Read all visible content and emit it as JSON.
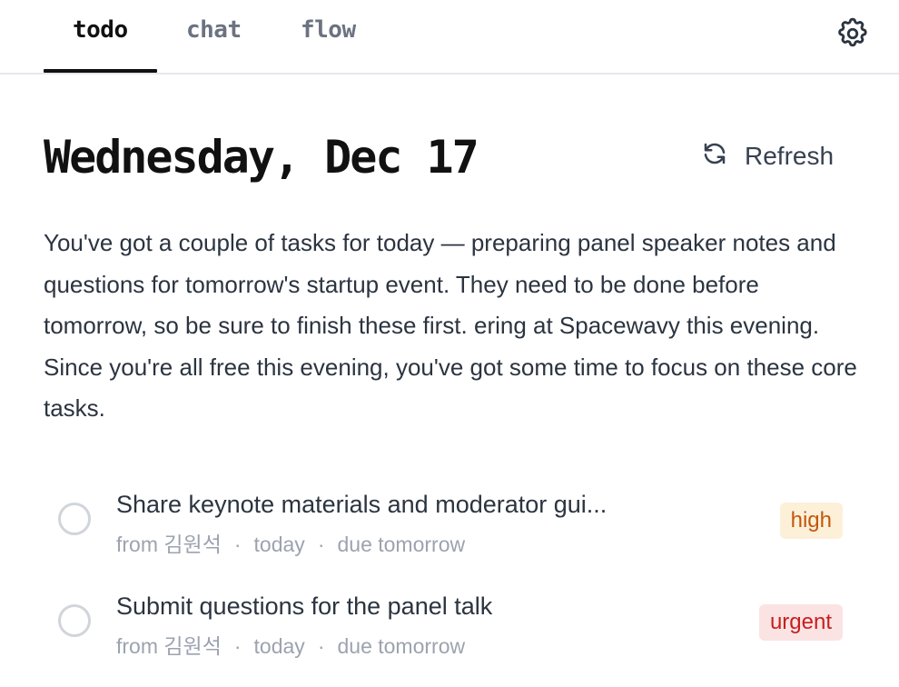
{
  "tabs": [
    {
      "label": "todo",
      "active": true
    },
    {
      "label": "chat",
      "active": false
    },
    {
      "label": "flow",
      "active": false
    }
  ],
  "settings": {
    "icon": "gear-icon"
  },
  "header": {
    "date_title": "Wednesday, Dec 17",
    "refresh_label": "Refresh",
    "refresh_icon": "refresh-icon"
  },
  "summary": "You've got a couple of tasks for today — preparing panel speaker notes and questions for tomorrow's startup event. They need to be done before tomorrow, so be sure to finish these first. ering at Spacewavy this evening. Since you're all free this evening, you've got some time to focus on these core tasks.",
  "tasks": [
    {
      "title": "Share keynote materials and moderator gui...",
      "from": "from 김원석",
      "created": "today",
      "due": "due tomorrow",
      "priority": "high",
      "done": false
    },
    {
      "title": "Submit questions for the panel talk",
      "from": "from 김원석",
      "created": "today",
      "due": "due tomorrow",
      "priority": "urgent",
      "done": false
    }
  ],
  "colors": {
    "high_bg": "#fdf0d9",
    "high_text": "#c2580c",
    "urgent_bg": "#fbe3e3",
    "urgent_text": "#c81e1e",
    "active_tab": "#111111"
  }
}
